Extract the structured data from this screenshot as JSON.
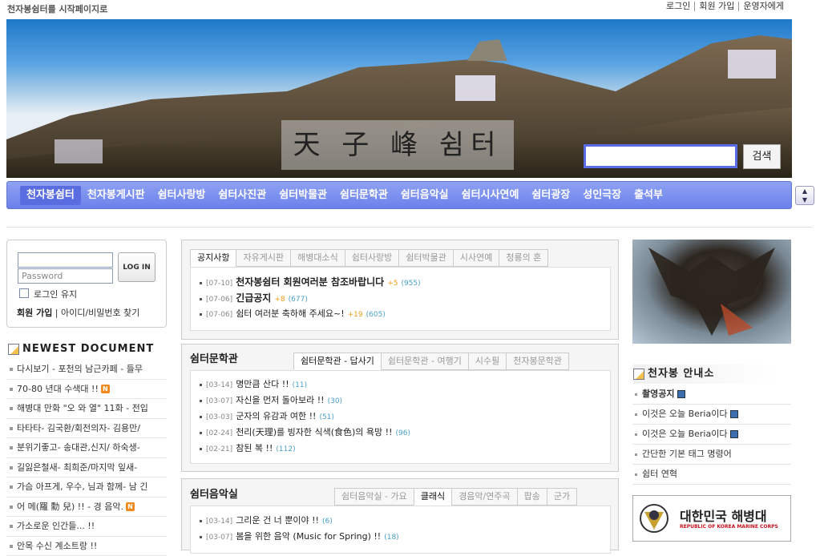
{
  "header": {
    "homepage_link": "천자봉쉼터를 시작페이지로",
    "links": [
      "로그인",
      "회원 가입",
      "운영자에게"
    ]
  },
  "banner": {
    "title": "天 子 峰 쉼터",
    "search_placeholder": "",
    "search_button": "검색"
  },
  "nav": {
    "items": [
      "천자봉쉼터",
      "천자봉게시판",
      "쉼터사랑방",
      "쉼터사진관",
      "쉼터박물관",
      "쉼터문학관",
      "쉼터음악실",
      "쉼터시사연예",
      "쉼터광장",
      "성인극장",
      "출석부"
    ],
    "active_index": 0
  },
  "login": {
    "id_value": "",
    "password_placeholder": "Password",
    "login_button": "LOG IN",
    "remember_label": "로그인 유지",
    "join_label": "회원 가입",
    "find_label": "아이디/비밀번호 찾기"
  },
  "newest": {
    "title": "NEWEST DOCUMENT",
    "items": [
      {
        "text": "다시보기 - 포천의 남근카페 - 들무",
        "new": false
      },
      {
        "text": "70-80 년대 수색대 !!",
        "new": true
      },
      {
        "text": "해병대 만화 \"오 와 열\" 11화 - 전입",
        "new": false
      },
      {
        "text": "타타타- 김국환/회전의자- 김용만/",
        "new": false
      },
      {
        "text": "분위기좋고- 송대관,신지/ 하숙생-",
        "new": false
      },
      {
        "text": "길잃은철새- 최희준/마지막 잎새-",
        "new": false
      },
      {
        "text": "가슴 아프게, 우수, 님과 함께- 남 긴",
        "new": false
      },
      {
        "text": "어 메(羅 勳 兒) !! - 경 음악.",
        "new": true
      },
      {
        "text": "가소로운 인간들... !!",
        "new": false
      },
      {
        "text": "안목 수신 계소트랑 !!",
        "new": false
      }
    ]
  },
  "notice_panel": {
    "tabs": [
      "공지사항",
      "자유게시판",
      "해병대소식",
      "쉼터사랑방",
      "쉼터박물관",
      "시사연예",
      "청룡의 혼"
    ],
    "active_tab": 0,
    "items": [
      {
        "date": "[07-10]",
        "title": "천자봉쉼터 회원여러분 참조바랍니다",
        "bold": true,
        "plus": "+5",
        "count": "(955)"
      },
      {
        "date": "[07-06]",
        "title": "긴급공지",
        "bold": true,
        "plus": "+8",
        "count": "(677)"
      },
      {
        "date": "[07-06]",
        "title": "쉼터 여러분 축하해 주세요~!",
        "bold": false,
        "plus": "+19",
        "count": "(605)"
      }
    ]
  },
  "literature_panel": {
    "title": "쉼터문학관",
    "tabs": [
      "쉼터문학관 - 답사기",
      "쉼터문학관 - 여행기",
      "시수필",
      "천자봉문학관"
    ],
    "active_tab": 0,
    "items": [
      {
        "date": "[03-14]",
        "title": "명만큼 산다 !!",
        "count": "(11)"
      },
      {
        "date": "[03-07]",
        "title": "자신을 먼저 돌아보라 !!",
        "count": "(30)"
      },
      {
        "date": "[03-03]",
        "title": "군자의 유감과 여한 !!",
        "count": "(51)"
      },
      {
        "date": "[02-24]",
        "title": "천리(天理)를 빙자한 식색(食色)의 욕망 !!",
        "count": "(96)"
      },
      {
        "date": "[02-21]",
        "title": "참된 복 !!",
        "count": "(112)"
      }
    ]
  },
  "music_panel": {
    "title": "쉼터음악실",
    "tabs": [
      "쉼터음악실 - 가요",
      "클래식",
      "경음악/연주곡",
      "팝송",
      "군가"
    ],
    "active_tab": 1,
    "items": [
      {
        "date": "[03-14]",
        "title": "그리운 건 너 뿐이야 !!",
        "count": "(6)"
      },
      {
        "date": "[03-07]",
        "title": "봄을 위한 음악 (Music for Spring) !!",
        "count": "(18)"
      }
    ]
  },
  "guide": {
    "title": "천자봉 안내소",
    "items": [
      {
        "text": "촬영공지",
        "bold": true,
        "save": true
      },
      {
        "text": "이것은 오늘 Beria이다",
        "bold": false,
        "save": true
      },
      {
        "text": "이것은 오늘 Beria이다",
        "bold": false,
        "save": true
      },
      {
        "text": "간단한 기본 태그 명령어",
        "bold": false,
        "save": false
      },
      {
        "text": "쉼터 연혁",
        "bold": false,
        "save": false
      }
    ]
  },
  "marine_banner": {
    "title": "대한민국 해병대",
    "subtitle": "REPUBLIC OF KOREA MARINE CORPS"
  },
  "colors": {
    "nav_bg": "#7b8ff0",
    "accent_orange": "#f29a1a",
    "count_blue": "#4aa0c8",
    "marine_red": "#c8141e"
  }
}
